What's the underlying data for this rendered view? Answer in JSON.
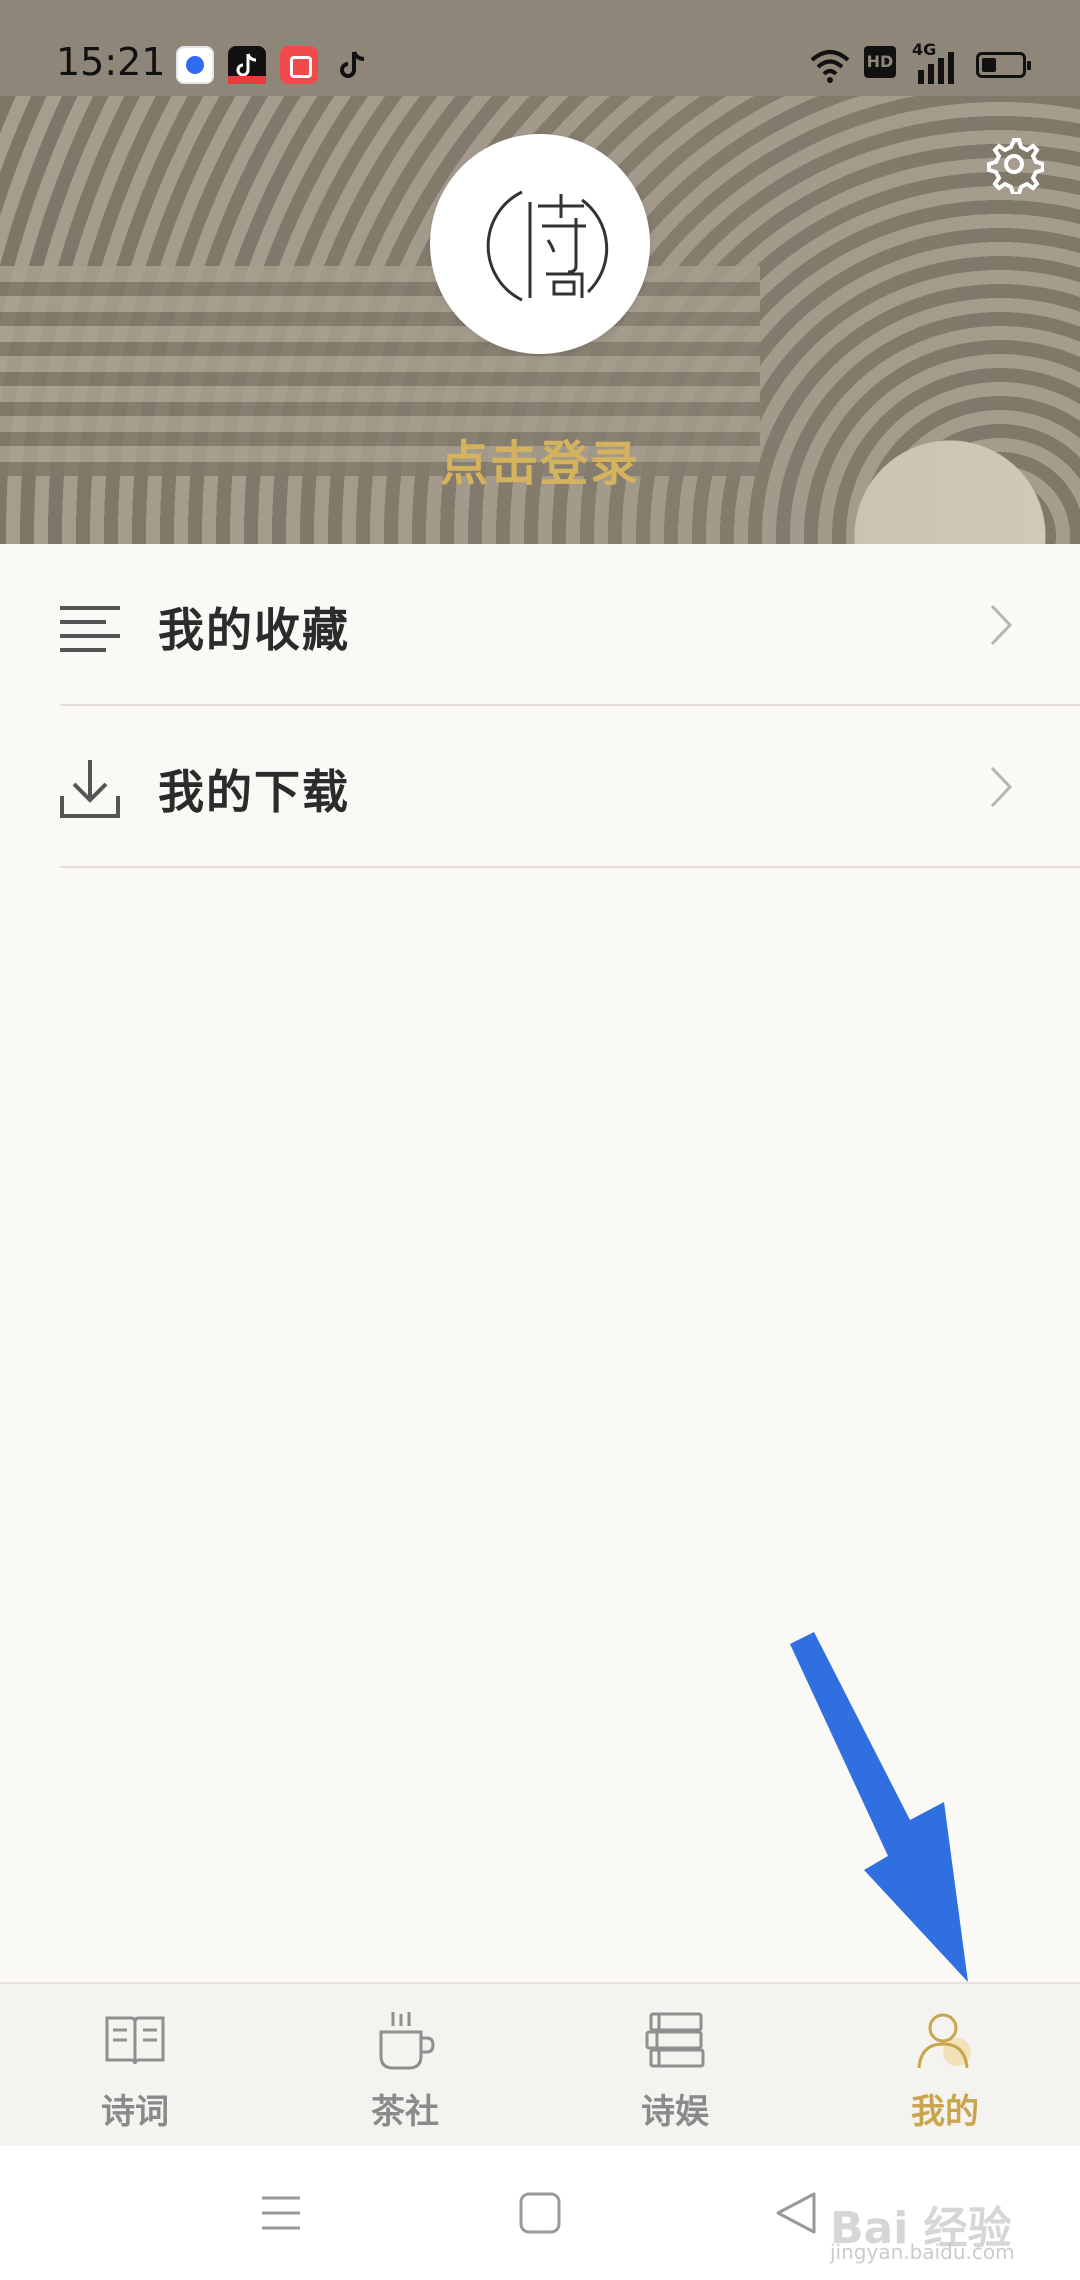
{
  "status_bar": {
    "time": "15:21",
    "notification_icons": [
      "baidu-app-icon",
      "douyin-lite-icon",
      "kuaishou-icon",
      "tiktok-icon"
    ],
    "system_icons": [
      "wifi-icon",
      "hd-icon",
      "signal-4g-icon",
      "battery-icon"
    ],
    "hd_label": "HD",
    "network_label": "4G"
  },
  "header": {
    "login_text": "点击登录",
    "avatar_icon": "shi-ci-logo-icon",
    "settings_icon": "gear-icon"
  },
  "menu": {
    "items": [
      {
        "label": "我的收藏",
        "icon": "list-icon"
      },
      {
        "label": "我的下载",
        "icon": "download-icon"
      }
    ]
  },
  "tabs": [
    {
      "label": "诗词",
      "icon": "book-icon",
      "active": false
    },
    {
      "label": "茶社",
      "icon": "tea-cup-icon",
      "active": false
    },
    {
      "label": "诗娱",
      "icon": "books-stack-icon",
      "active": false
    },
    {
      "label": "我的",
      "icon": "person-icon",
      "active": true
    }
  ],
  "nav": [
    "menu-icon",
    "home-icon",
    "back-icon"
  ],
  "watermark": {
    "text": "Bai 经验",
    "sub": "jingyan.baidu.com"
  },
  "colors": {
    "accent_gold": "#d4b25e",
    "tab_active": "#c9a54e",
    "tab_inactive": "#8a8a8a",
    "background": "#fbf9f5",
    "annotation_arrow": "#2f6fe0"
  }
}
